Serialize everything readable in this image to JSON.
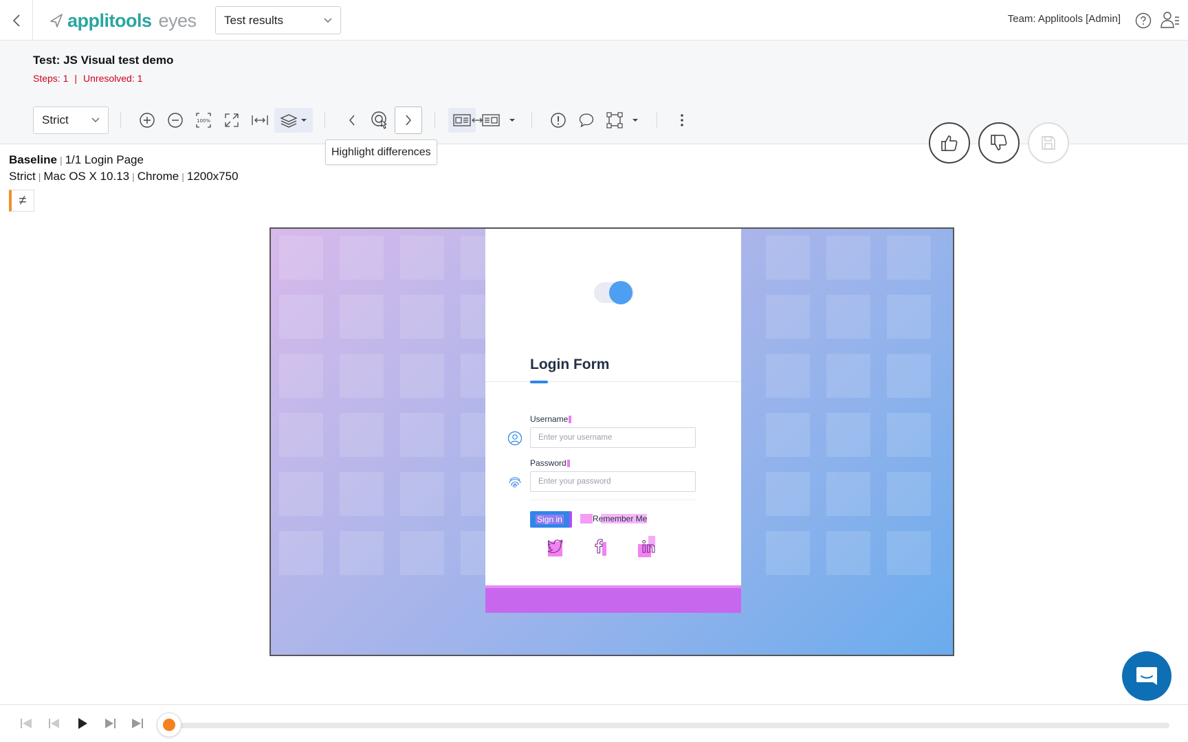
{
  "header": {
    "logo_brand": "applitools",
    "logo_suffix": "eyes",
    "view_select": "Test results",
    "team": "Team: Applitools [Admin]"
  },
  "test": {
    "title": "Test: JS Visual test demo",
    "steps": "Steps: 1",
    "unresolved": "Unresolved: 1"
  },
  "toolbar": {
    "match_level": "Strict",
    "tooltip": "Highlight differences"
  },
  "baseline": {
    "label": "Baseline",
    "step": "1/1 Login Page",
    "match": "Strict",
    "os": "Mac OS X 10.13",
    "browser": "Chrome",
    "viewport": "1200x750",
    "diff_symbol": "≠"
  },
  "screenshot": {
    "form_title": "Login Form",
    "username_label": "Username",
    "username_placeholder": "Enter your username",
    "password_label": "Password",
    "password_placeholder": "Enter your password",
    "signin_label": "Sign in",
    "remember_label": "Remember Me"
  },
  "colors": {
    "brand": "#2aa5a0",
    "error": "#d0021b",
    "accent_orange": "#f5821f",
    "chat": "#0e6fb5",
    "diff_highlight": "#ef6ef0"
  },
  "player": {
    "progress": 0
  }
}
